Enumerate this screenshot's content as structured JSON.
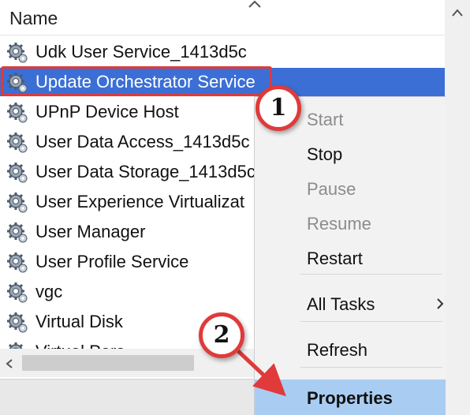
{
  "header": {
    "column_name": "Name"
  },
  "services": [
    {
      "name": "Udk User Service_1413d5c",
      "icon": "service-gear-icon"
    },
    {
      "name": "Update Orchestrator Service",
      "icon": "service-gear-icon"
    },
    {
      "name": "UPnP Device Host",
      "icon": "service-gear-icon"
    },
    {
      "name": "User Data Access_1413d5c",
      "icon": "service-gear-icon"
    },
    {
      "name": "User Data Storage_1413d5c",
      "icon": "service-gear-icon"
    },
    {
      "name": "User Experience Virtualizat",
      "icon": "service-gear-icon"
    },
    {
      "name": "User Manager",
      "icon": "service-gear-icon"
    },
    {
      "name": "User Profile Service",
      "icon": "service-gear-icon"
    },
    {
      "name": "vgc",
      "icon": "service-gear-icon"
    },
    {
      "name": "Virtual Disk",
      "icon": "service-gear-icon"
    },
    {
      "name": "Virtual Pers...",
      "icon": "service-gear-icon"
    }
  ],
  "selected_service_index": 1,
  "context_menu": {
    "items": [
      {
        "label": "Start",
        "enabled": false
      },
      {
        "label": "Stop",
        "enabled": true
      },
      {
        "label": "Pause",
        "enabled": false
      },
      {
        "label": "Resume",
        "enabled": false
      },
      {
        "label": "Restart",
        "enabled": true
      },
      {
        "label": "All Tasks",
        "enabled": true,
        "has_submenu": true
      },
      {
        "label": "Refresh",
        "enabled": true
      },
      {
        "label": "Properties",
        "enabled": true,
        "highlighted": true
      }
    ]
  },
  "callouts": {
    "step1": "1",
    "step2": "2"
  },
  "colors": {
    "selection": "#3b6fd6",
    "menu_hover": "#a9cdf2",
    "callout_border": "#e03a3a",
    "menu_bg": "#f2f2f2"
  }
}
